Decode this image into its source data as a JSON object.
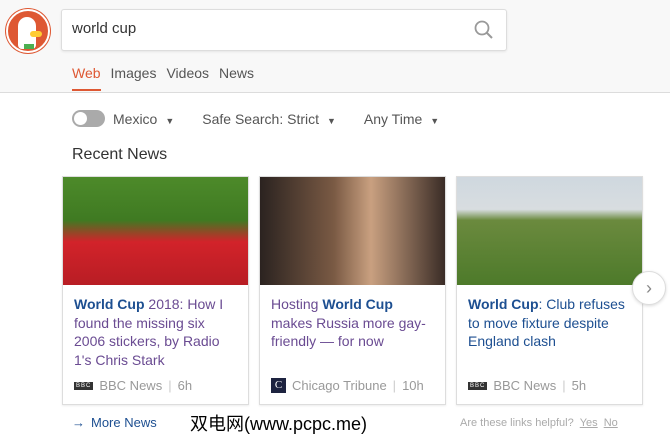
{
  "search": {
    "query": "world cup"
  },
  "tabs": [
    {
      "label": "Web"
    },
    {
      "label": "Images"
    },
    {
      "label": "Videos"
    },
    {
      "label": "News"
    }
  ],
  "filters": {
    "region": "Mexico",
    "safe_search": "Safe Search: Strict",
    "time": "Any Time"
  },
  "section_title": "Recent News",
  "cards": [
    {
      "title_bold": "World Cup",
      "title_rest": " 2018: How I found the missing six 2006 stickers, by Radio 1's Chris Stark",
      "source": "BBC News",
      "source_logo": "BBC",
      "age": "6h"
    },
    {
      "title_pre": "Hosting ",
      "title_bold": "World Cup",
      "title_rest": " makes Russia more gay-friendly — for now",
      "source": "Chicago Tribune",
      "source_logo": "C",
      "age": "10h"
    },
    {
      "title_bold": "World Cup",
      "title_rest": ": Club refuses to move fixture despite England clash",
      "source": "BBC News",
      "source_logo": "BBC",
      "age": "5h"
    }
  ],
  "more_news": "More News",
  "watermark": "双电网(www.pcpc.me)",
  "feedback": {
    "question": "Are these links helpful?",
    "yes": "Yes",
    "no": "No"
  },
  "colors": {
    "accent": "#de5833",
    "link": "#1d4f91",
    "visited": "#6a4b92"
  }
}
